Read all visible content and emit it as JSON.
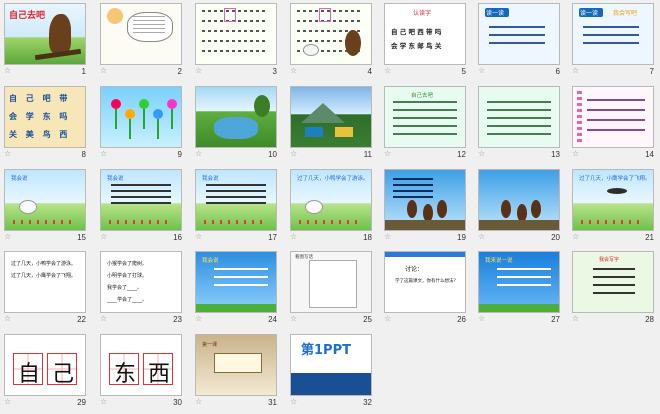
{
  "slides": [
    {
      "n": "1",
      "title": "自己去吧",
      "style": "cover"
    },
    {
      "n": "2",
      "style": "cartoon"
    },
    {
      "n": "3",
      "style": "pinyin"
    },
    {
      "n": "4",
      "style": "pinyin-eagle"
    },
    {
      "n": "5",
      "heading": "认读字",
      "lines": [
        "自 己 吧 西 带 吗",
        "会 学 东 邮 鸟 关"
      ],
      "style": "words"
    },
    {
      "n": "6",
      "heading": "读一读",
      "style": "blue"
    },
    {
      "n": "7",
      "heading": "读一读",
      "subheading": "我会写吧",
      "style": "blue2"
    },
    {
      "n": "8",
      "lines": [
        "自 己 吧 带",
        "会 学 东 吗",
        "关 美 鸟 西"
      ],
      "style": "flowers"
    },
    {
      "n": "9",
      "style": "lollipop"
    },
    {
      "n": "10",
      "style": "river"
    },
    {
      "n": "11",
      "style": "mountain"
    },
    {
      "n": "12",
      "heading": "自己去吧",
      "style": "greentext"
    },
    {
      "n": "13",
      "style": "greentext"
    },
    {
      "n": "14",
      "style": "notebook"
    },
    {
      "n": "15",
      "heading": "我会说",
      "style": "meadow"
    },
    {
      "n": "16",
      "heading": "我会说",
      "style": "meadowtext"
    },
    {
      "n": "17",
      "heading": "我会说",
      "style": "meadowtext"
    },
    {
      "n": "18",
      "heading": "过了几天，小鸭学会了游泳。",
      "style": "meadow"
    },
    {
      "n": "19",
      "style": "bluelist"
    },
    {
      "n": "20",
      "style": "eagles"
    },
    {
      "n": "21",
      "heading": "过了几天，小鹰学会了飞翔。",
      "style": "eagle-sky"
    },
    {
      "n": "22",
      "lines": [
        "过了几天，小鸭学会了游泳。",
        "过了几天，小鹰学会了飞翔。"
      ],
      "style": "plain"
    },
    {
      "n": "23",
      "lines": [
        "小猴学会了爬树。",
        "小明学会了打球。",
        "我学会了____。",
        "____学会了____。"
      ],
      "style": "plain"
    },
    {
      "n": "24",
      "heading": "我会说",
      "style": "bluetext"
    },
    {
      "n": "25",
      "heading": "看图写话",
      "style": "paper"
    },
    {
      "n": "26",
      "heading": "讨论：",
      "lines": [
        "学了这篇课文，你有什么想法？"
      ],
      "style": "discuss"
    },
    {
      "n": "27",
      "heading": "我来说一说",
      "style": "bluetext2"
    },
    {
      "n": "28",
      "heading": "我会写字",
      "style": "poem"
    },
    {
      "n": "29",
      "chars": [
        "自",
        "己"
      ],
      "style": "tianzi"
    },
    {
      "n": "30",
      "chars": [
        "东",
        "西"
      ],
      "style": "tianzi"
    },
    {
      "n": "31",
      "heading": "第一课",
      "style": "brown"
    },
    {
      "n": "32",
      "brand": "第1PPT",
      "style": "brand"
    }
  ],
  "colors": {
    "cover_title": "#e0262f",
    "blue_bg": "#1469b8",
    "flower": "#f0a800",
    "green_text": "#2d8f3b"
  }
}
